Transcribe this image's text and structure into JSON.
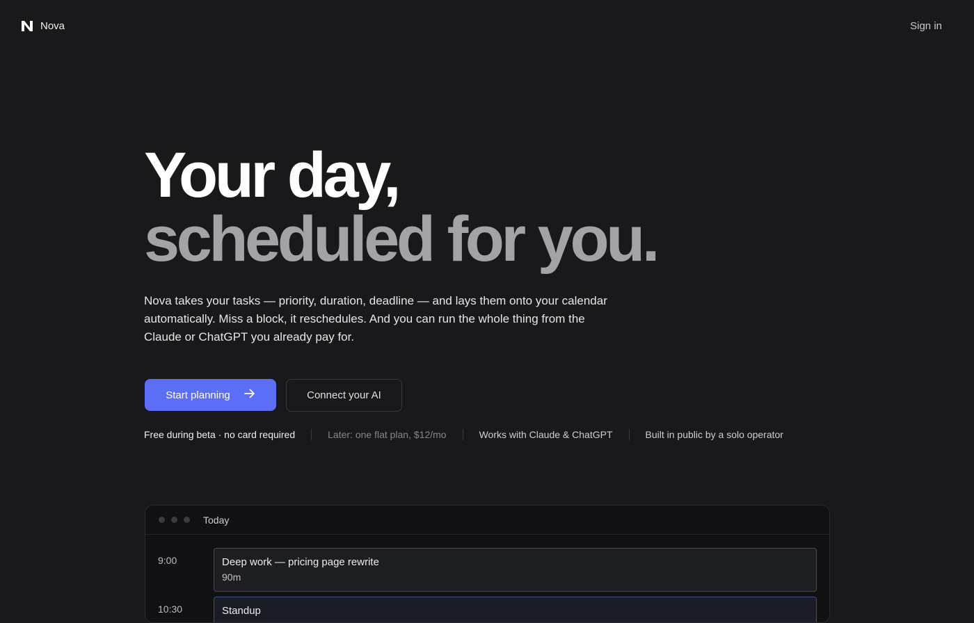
{
  "nav": {
    "brand_name": "Nova",
    "sign_in_label": "Sign in",
    "logo_icon": "n-logo-icon"
  },
  "hero": {
    "headline_line1": "Your day,",
    "headline_line2": "scheduled for you.",
    "description": "Nova takes your tasks — priority, duration, deadline — and lays them onto your calendar automatically. Miss a block, it reschedules. And you can run the whole thing from the Claude or ChatGPT you already pay for.",
    "primary_cta": "Start planning",
    "primary_cta_icon": "arrow-right-icon",
    "secondary_cta": "Connect your AI",
    "accent_color": "#5b6ef5"
  },
  "facts": [
    {
      "text": "Free during beta · no card required",
      "color": "#f0f0f2"
    },
    {
      "text": "Later: one flat plan, $12/mo",
      "color": "#86868a"
    },
    {
      "text": "Works with Claude & ChatGPT",
      "color": "#cfcfd2"
    },
    {
      "text": "Built in public by a solo operator",
      "color": "#cfcfd2"
    }
  ],
  "preview": {
    "title": "Today",
    "schedule": [
      {
        "time": "9:00",
        "title": "Deep work — pricing page rewrite",
        "duration": "90m"
      },
      {
        "time": "10:30",
        "title": "Standup",
        "duration": ""
      }
    ]
  }
}
